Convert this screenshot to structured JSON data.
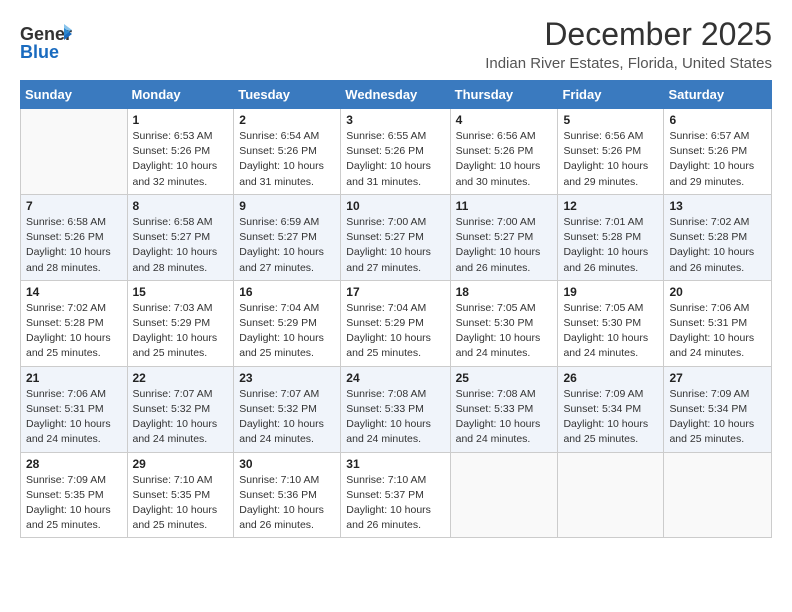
{
  "logo": {
    "line1": "General",
    "line2": "Blue",
    "icon": "▶"
  },
  "title": "December 2025",
  "subtitle": "Indian River Estates, Florida, United States",
  "headers": [
    "Sunday",
    "Monday",
    "Tuesday",
    "Wednesday",
    "Thursday",
    "Friday",
    "Saturday"
  ],
  "weeks": [
    [
      {
        "num": "",
        "info": ""
      },
      {
        "num": "1",
        "info": "Sunrise: 6:53 AM\nSunset: 5:26 PM\nDaylight: 10 hours\nand 32 minutes."
      },
      {
        "num": "2",
        "info": "Sunrise: 6:54 AM\nSunset: 5:26 PM\nDaylight: 10 hours\nand 31 minutes."
      },
      {
        "num": "3",
        "info": "Sunrise: 6:55 AM\nSunset: 5:26 PM\nDaylight: 10 hours\nand 31 minutes."
      },
      {
        "num": "4",
        "info": "Sunrise: 6:56 AM\nSunset: 5:26 PM\nDaylight: 10 hours\nand 30 minutes."
      },
      {
        "num": "5",
        "info": "Sunrise: 6:56 AM\nSunset: 5:26 PM\nDaylight: 10 hours\nand 29 minutes."
      },
      {
        "num": "6",
        "info": "Sunrise: 6:57 AM\nSunset: 5:26 PM\nDaylight: 10 hours\nand 29 minutes."
      }
    ],
    [
      {
        "num": "7",
        "info": "Sunrise: 6:58 AM\nSunset: 5:26 PM\nDaylight: 10 hours\nand 28 minutes."
      },
      {
        "num": "8",
        "info": "Sunrise: 6:58 AM\nSunset: 5:27 PM\nDaylight: 10 hours\nand 28 minutes."
      },
      {
        "num": "9",
        "info": "Sunrise: 6:59 AM\nSunset: 5:27 PM\nDaylight: 10 hours\nand 27 minutes."
      },
      {
        "num": "10",
        "info": "Sunrise: 7:00 AM\nSunset: 5:27 PM\nDaylight: 10 hours\nand 27 minutes."
      },
      {
        "num": "11",
        "info": "Sunrise: 7:00 AM\nSunset: 5:27 PM\nDaylight: 10 hours\nand 26 minutes."
      },
      {
        "num": "12",
        "info": "Sunrise: 7:01 AM\nSunset: 5:28 PM\nDaylight: 10 hours\nand 26 minutes."
      },
      {
        "num": "13",
        "info": "Sunrise: 7:02 AM\nSunset: 5:28 PM\nDaylight: 10 hours\nand 26 minutes."
      }
    ],
    [
      {
        "num": "14",
        "info": "Sunrise: 7:02 AM\nSunset: 5:28 PM\nDaylight: 10 hours\nand 25 minutes."
      },
      {
        "num": "15",
        "info": "Sunrise: 7:03 AM\nSunset: 5:29 PM\nDaylight: 10 hours\nand 25 minutes."
      },
      {
        "num": "16",
        "info": "Sunrise: 7:04 AM\nSunset: 5:29 PM\nDaylight: 10 hours\nand 25 minutes."
      },
      {
        "num": "17",
        "info": "Sunrise: 7:04 AM\nSunset: 5:29 PM\nDaylight: 10 hours\nand 25 minutes."
      },
      {
        "num": "18",
        "info": "Sunrise: 7:05 AM\nSunset: 5:30 PM\nDaylight: 10 hours\nand 24 minutes."
      },
      {
        "num": "19",
        "info": "Sunrise: 7:05 AM\nSunset: 5:30 PM\nDaylight: 10 hours\nand 24 minutes."
      },
      {
        "num": "20",
        "info": "Sunrise: 7:06 AM\nSunset: 5:31 PM\nDaylight: 10 hours\nand 24 minutes."
      }
    ],
    [
      {
        "num": "21",
        "info": "Sunrise: 7:06 AM\nSunset: 5:31 PM\nDaylight: 10 hours\nand 24 minutes."
      },
      {
        "num": "22",
        "info": "Sunrise: 7:07 AM\nSunset: 5:32 PM\nDaylight: 10 hours\nand 24 minutes."
      },
      {
        "num": "23",
        "info": "Sunrise: 7:07 AM\nSunset: 5:32 PM\nDaylight: 10 hours\nand 24 minutes."
      },
      {
        "num": "24",
        "info": "Sunrise: 7:08 AM\nSunset: 5:33 PM\nDaylight: 10 hours\nand 24 minutes."
      },
      {
        "num": "25",
        "info": "Sunrise: 7:08 AM\nSunset: 5:33 PM\nDaylight: 10 hours\nand 24 minutes."
      },
      {
        "num": "26",
        "info": "Sunrise: 7:09 AM\nSunset: 5:34 PM\nDaylight: 10 hours\nand 25 minutes."
      },
      {
        "num": "27",
        "info": "Sunrise: 7:09 AM\nSunset: 5:34 PM\nDaylight: 10 hours\nand 25 minutes."
      }
    ],
    [
      {
        "num": "28",
        "info": "Sunrise: 7:09 AM\nSunset: 5:35 PM\nDaylight: 10 hours\nand 25 minutes."
      },
      {
        "num": "29",
        "info": "Sunrise: 7:10 AM\nSunset: 5:35 PM\nDaylight: 10 hours\nand 25 minutes."
      },
      {
        "num": "30",
        "info": "Sunrise: 7:10 AM\nSunset: 5:36 PM\nDaylight: 10 hours\nand 26 minutes."
      },
      {
        "num": "31",
        "info": "Sunrise: 7:10 AM\nSunset: 5:37 PM\nDaylight: 10 hours\nand 26 minutes."
      },
      {
        "num": "",
        "info": ""
      },
      {
        "num": "",
        "info": ""
      },
      {
        "num": "",
        "info": ""
      }
    ]
  ]
}
